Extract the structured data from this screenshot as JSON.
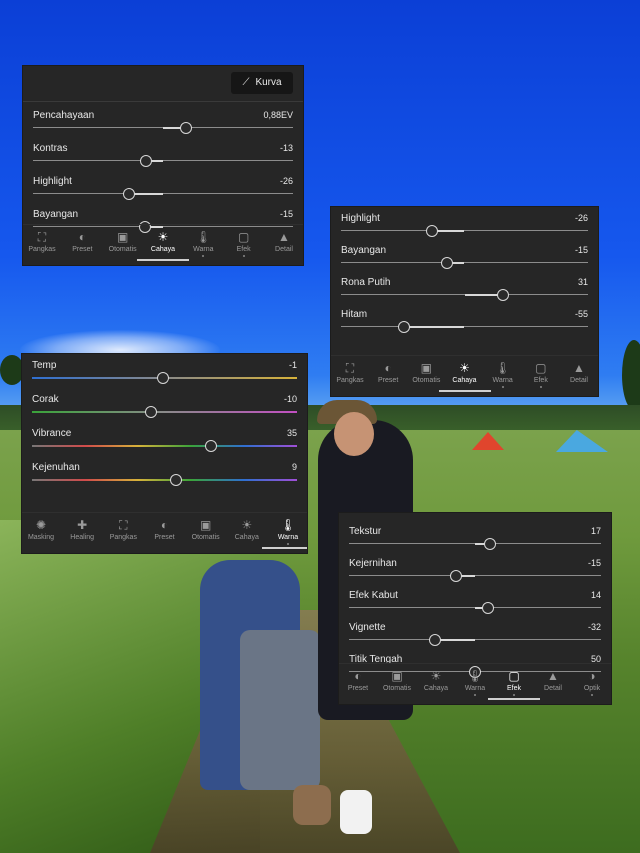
{
  "panel1": {
    "kurva_label": "Kurva",
    "sliders": [
      {
        "label": "Pencahayaan",
        "value": "0,88EV",
        "level": 0.59,
        "bipolar": true
      },
      {
        "label": "Kontras",
        "value": "-13",
        "level": 0.435,
        "bipolar": true
      },
      {
        "label": "Highlight",
        "value": "-26",
        "level": 0.37,
        "bipolar": true
      },
      {
        "label": "Bayangan",
        "value": "-15",
        "level": 0.43,
        "bipolar": true
      }
    ],
    "tabs": [
      {
        "label": "Pangkas",
        "icon": "crop-icon",
        "glyph": "⛶"
      },
      {
        "label": "Preset",
        "icon": "preset-icon",
        "glyph": "◐"
      },
      {
        "label": "Otomatis",
        "icon": "auto-icon",
        "glyph": "▣"
      },
      {
        "label": "Cahaya",
        "icon": "light-icon",
        "glyph": "☀",
        "active": true
      },
      {
        "label": "Warna",
        "icon": "color-icon",
        "glyph": "🌡"
      },
      {
        "label": "Efek",
        "icon": "effects-icon",
        "glyph": "▢"
      },
      {
        "label": "Detail",
        "icon": "detail-icon",
        "glyph": "▲"
      }
    ]
  },
  "panel2": {
    "sliders": [
      {
        "label": "Highlight",
        "value": "-26",
        "level": 0.37,
        "bipolar": true
      },
      {
        "label": "Bayangan",
        "value": "-15",
        "level": 0.43,
        "bipolar": true
      },
      {
        "label": "Rona Putih",
        "value": "31",
        "level": 0.655,
        "bipolar": true
      },
      {
        "label": "Hitam",
        "value": "-55",
        "level": 0.255,
        "bipolar": true
      }
    ],
    "tabs": [
      {
        "label": "Pangkas",
        "icon": "crop-icon",
        "glyph": "⛶"
      },
      {
        "label": "Preset",
        "icon": "preset-icon",
        "glyph": "◐"
      },
      {
        "label": "Otomatis",
        "icon": "auto-icon",
        "glyph": "▣"
      },
      {
        "label": "Cahaya",
        "icon": "light-icon",
        "glyph": "☀",
        "active": true
      },
      {
        "label": "Warna",
        "icon": "color-icon",
        "glyph": "🌡"
      },
      {
        "label": "Efek",
        "icon": "effects-icon",
        "glyph": "▢"
      },
      {
        "label": "Detail",
        "icon": "detail-icon",
        "glyph": "▲"
      }
    ]
  },
  "panel3": {
    "sliders": [
      {
        "label": "Temp",
        "value": "-1",
        "level": 0.495,
        "gradient": "linear-gradient(90deg,#2f6fd1,#8a8a8a 50%,#d6b23a)"
      },
      {
        "label": "Corak",
        "value": "-10",
        "level": 0.45,
        "gradient": "linear-gradient(90deg,#3aa33a,#8a8a8a 50%,#c24fc2)"
      },
      {
        "label": "Vibrance",
        "value": "35",
        "level": 0.675,
        "gradient": "linear-gradient(90deg,#777,#d14b4b 20%,#d6b23a 40%,#3aa33a 60%,#2f6fd1 80%,#a04fd6)"
      },
      {
        "label": "Kejenuhan",
        "value": "9",
        "level": 0.545,
        "gradient": "linear-gradient(90deg,#777,#d14b4b 20%,#d6b23a 40%,#3aa33a 60%,#2f6fd1 80%,#a04fd6)"
      }
    ],
    "tabs": [
      {
        "label": "Masking",
        "icon": "masking-icon",
        "glyph": "✺"
      },
      {
        "label": "Healing",
        "icon": "healing-icon",
        "glyph": "✚"
      },
      {
        "label": "Pangkas",
        "icon": "crop-icon",
        "glyph": "⛶"
      },
      {
        "label": "Preset",
        "icon": "preset-icon",
        "glyph": "◐"
      },
      {
        "label": "Otomatis",
        "icon": "auto-icon",
        "glyph": "▣"
      },
      {
        "label": "Cahaya",
        "icon": "light-icon",
        "glyph": "☀"
      },
      {
        "label": "Warna",
        "icon": "color-icon",
        "glyph": "🌡",
        "active": true
      }
    ]
  },
  "panel4": {
    "sliders": [
      {
        "label": "Tekstur",
        "value": "17",
        "level": 0.56,
        "bipolar": true
      },
      {
        "label": "Kejernihan",
        "value": "-15",
        "level": 0.425,
        "bipolar": true
      },
      {
        "label": "Efek Kabut",
        "value": "14",
        "level": 0.55,
        "bipolar": true
      },
      {
        "label": "Vignette",
        "value": "-32",
        "level": 0.34,
        "bipolar": true
      },
      {
        "label": "Titik Tengah",
        "value": "50",
        "level": 0.5,
        "bipolar": false
      }
    ],
    "tabs": [
      {
        "label": "Preset",
        "icon": "preset-icon",
        "glyph": "◐"
      },
      {
        "label": "Otomatis",
        "icon": "auto-icon",
        "glyph": "▣"
      },
      {
        "label": "Cahaya",
        "icon": "light-icon",
        "glyph": "☀"
      },
      {
        "label": "Warna",
        "icon": "color-icon",
        "glyph": "🌡"
      },
      {
        "label": "Efek",
        "icon": "effects-icon",
        "glyph": "▢",
        "active": true
      },
      {
        "label": "Detail",
        "icon": "detail-icon",
        "glyph": "▲"
      },
      {
        "label": "Optik",
        "icon": "optics-icon",
        "glyph": "◑"
      }
    ]
  }
}
